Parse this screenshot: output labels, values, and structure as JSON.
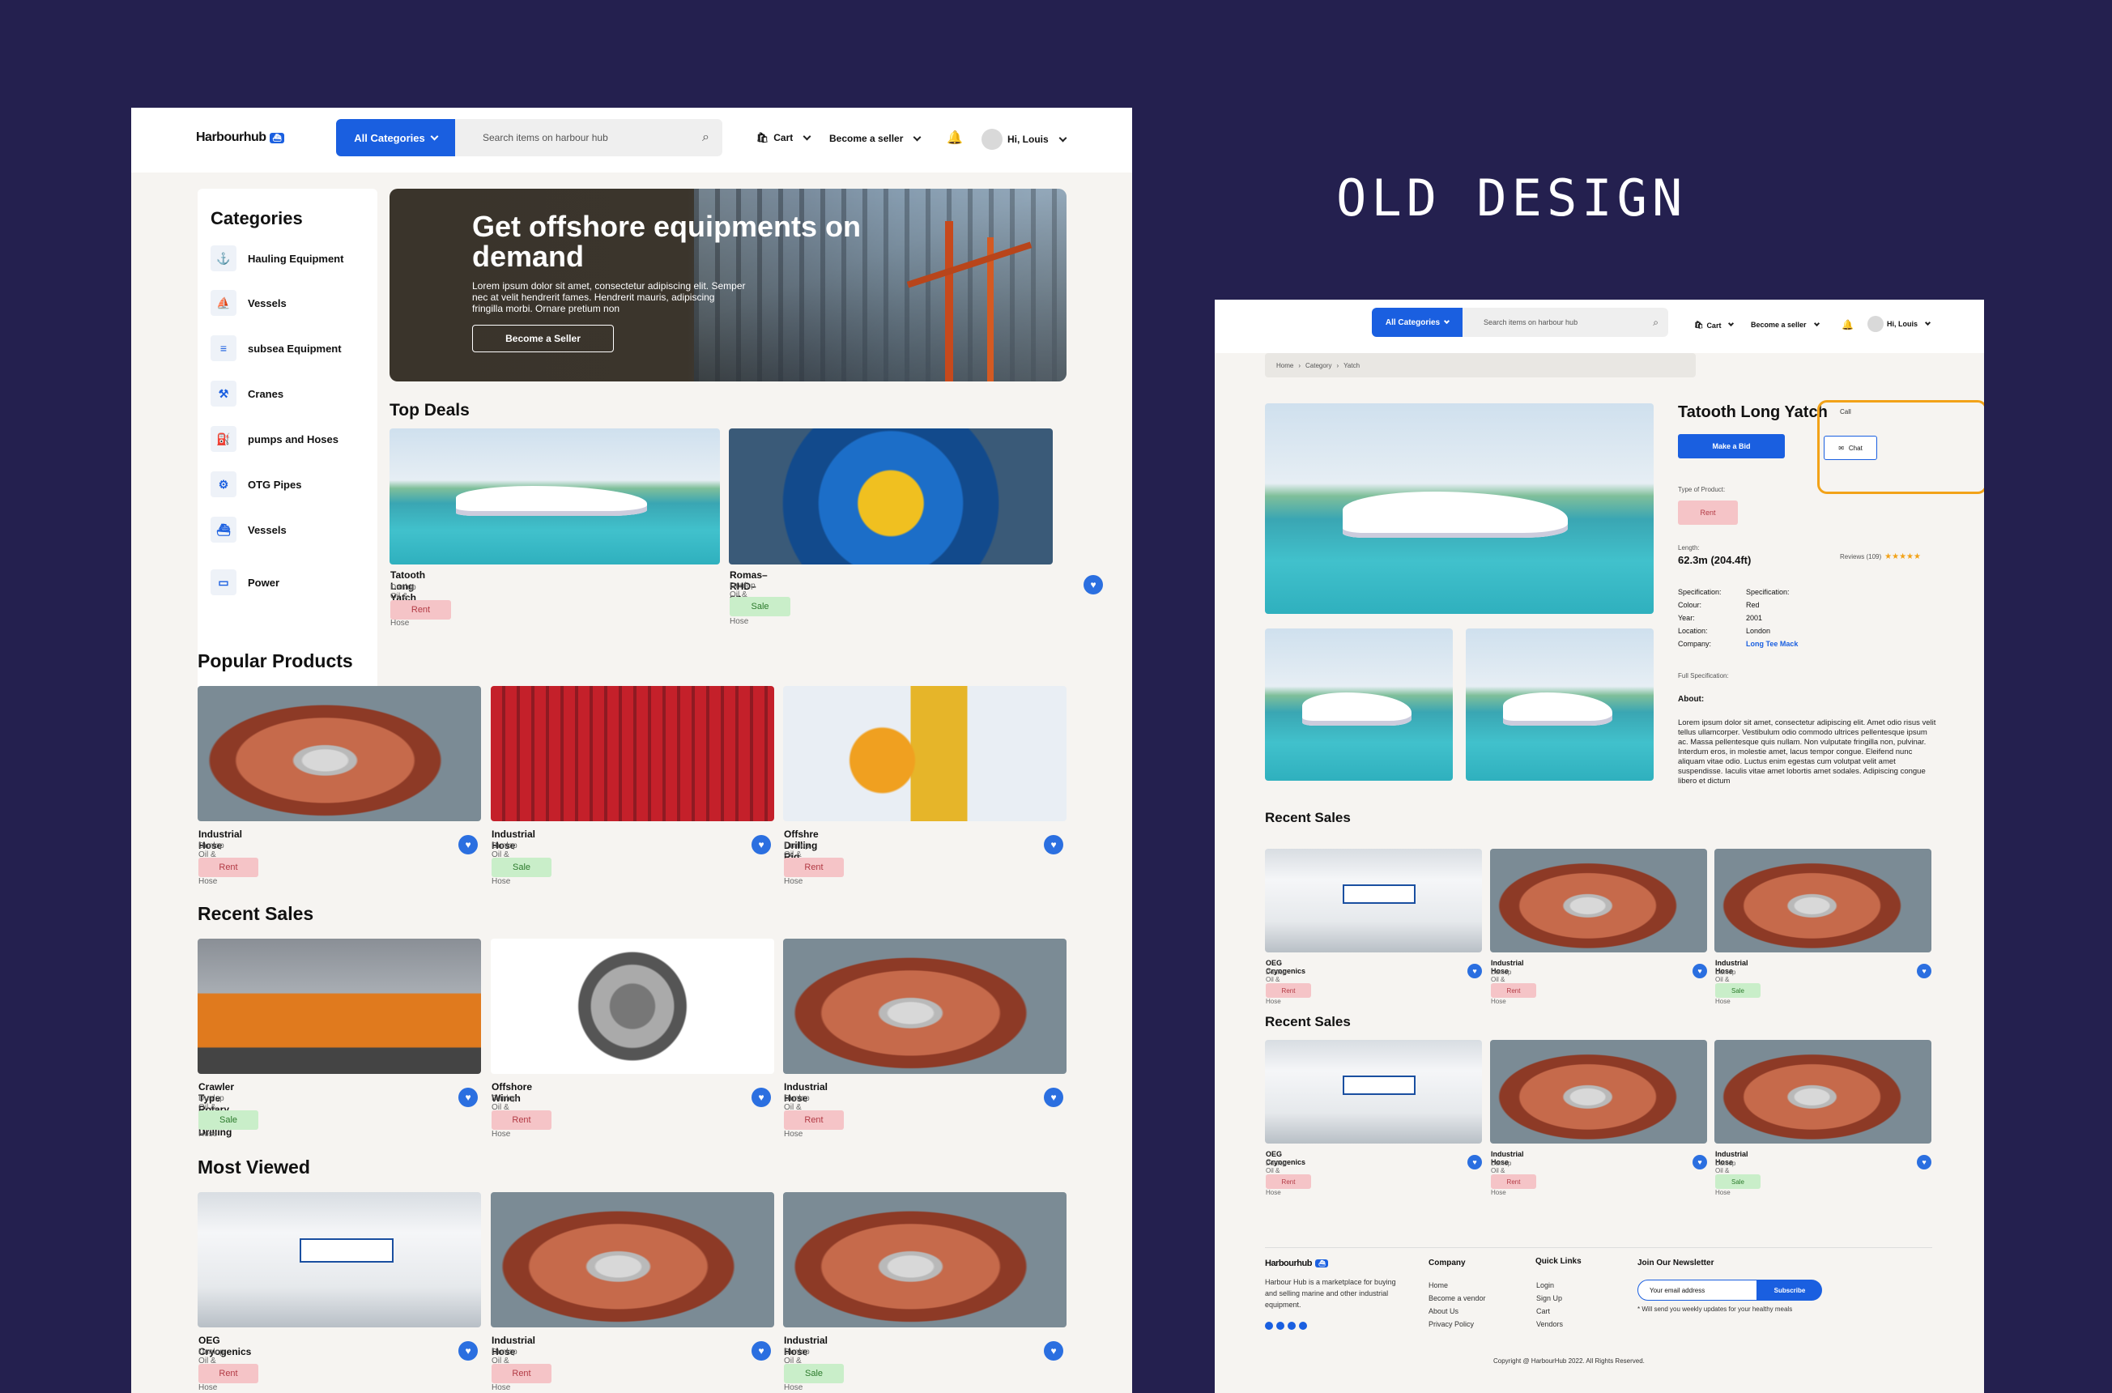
{
  "home": {
    "logo": "Harbourhub",
    "logo_mark": "⛴",
    "categories_button": "All Categories",
    "search_placeholder": "Search items on harbour hub",
    "cart": "Cart",
    "become_seller": "Become a seller",
    "greeting": "Hi, Louis",
    "categories_title": "Categories",
    "categories": [
      "Hauling Equipment",
      "Vessels",
      "subsea Equipment",
      "Cranes",
      "pumps and Hoses",
      "OTG Pipes",
      "Vessels",
      "Power"
    ],
    "hero": {
      "title": "Get offshore equipments on demand",
      "text": "Lorem ipsum dolor sit amet, consectetur adipiscing elit. Semper nec at velit hendrerit fames. Hendrerit mauris, adipiscing fringilla morbi. Ornare pretium non",
      "button": "Become a Seller"
    },
    "top_deals_title": "Top Deals",
    "top_deals": [
      {
        "title": "Tatooth Long Yatch",
        "subtitle": "Dunlop Oil & Marine Industrail Hose",
        "badge": "Rent"
      },
      {
        "title": "Romas–RHD–on–Pride",
        "subtitle": "Dunlop Oil & Marine Industrail Hose",
        "badge": "Sale"
      }
    ],
    "popular_title": "Popular Products",
    "popular": [
      {
        "title": "Industrial Hose",
        "subtitle": "Dunlop Oil & Marine Industrail Hose",
        "badge": "Rent"
      },
      {
        "title": "Industrial Hose",
        "subtitle": "Dunlop Oil & Marine Industrail Hose",
        "badge": "Sale"
      },
      {
        "title": "Offshre Drilling Rig",
        "subtitle": "Dunlop Oil & Marine Industrail Hose",
        "badge": "Rent"
      }
    ],
    "recent_title": "Recent Sales",
    "recent": [
      {
        "title": "Crawler Type Rotary Well Drilling",
        "subtitle": "Dunlop Oil & Marine Industrail Hose",
        "badge": "Sale"
      },
      {
        "title": "Offshore Winch",
        "subtitle": "Dunlop Oil & Marine Industrail Hose",
        "badge": "Rent"
      },
      {
        "title": "Industrial Hose",
        "subtitle": "Dunlop Oil & Marine Industrail Hose",
        "badge": "Rent"
      }
    ],
    "most_viewed_title": "Most Viewed",
    "most_viewed": [
      {
        "title": "OEG Cryogenics",
        "subtitle": "Dunlop Oil & Marine Industrail Hose",
        "badge": "Rent"
      },
      {
        "title": "Industrial Hose",
        "subtitle": "Dunlop Oil & Marine Industrail Hose",
        "badge": "Rent"
      },
      {
        "title": "Industrial Hose",
        "subtitle": "Dunlop Oil & Marine Industrail Hose",
        "badge": "Sale"
      }
    ]
  },
  "label": "OLD DESIGN",
  "detail": {
    "categories_button": "All Categories",
    "search_placeholder": "Search items on harbour hub",
    "cart": "Cart",
    "become_seller": "Become a seller",
    "greeting": "Hi, Louis",
    "breadcrumb": [
      "Home",
      "Category",
      "Yatch"
    ],
    "title": "Tatooth Long Yatch",
    "bid_button": "Make a Bid",
    "call": "Call",
    "chat": "Chat",
    "type_label": "Type of Product:",
    "type_value": "Rent",
    "length_label": "Length:",
    "length_value": "62.3m (204.4ft)",
    "reviews": "Reviews (109)",
    "stars": "★★★★★",
    "specs": [
      {
        "k": "Specification:",
        "v": "Specification:"
      },
      {
        "k": "Colour:",
        "v": "Red"
      },
      {
        "k": "Year:",
        "v": "2001"
      },
      {
        "k": "Location:",
        "v": "London"
      },
      {
        "k": "Company:",
        "v": "Long Tee Mack"
      }
    ],
    "full_spec": "Full Specification:",
    "about_title": "About:",
    "about_text": "Lorem ipsum dolor sit amet, consectetur adipiscing elit. Amet odio risus velit tellus ullamcorper. Vestibulum odio commodo ultrices pellentesque ipsum ac. Massa pellentesque quis nullam. Non vulputate fringilla non, pulvinar. Interdum eros, in molestie amet, lacus tempor congue. Eleifend nunc aliquam vitae odio. Luctus enim egestas cum volutpat velit amet suspendisse. Iaculis vitae amet lobortis amet sodales. Adipiscing congue libero et dictum",
    "recent_title_1": "Recent Sales",
    "recent_title_2": "Recent Sales",
    "recent": [
      {
        "title": "OEG Cryogenics",
        "subtitle": "Dunlop Oil & Marine Industrail Hose",
        "badge": "Rent"
      },
      {
        "title": "Industrial Hose",
        "subtitle": "Dunlop Oil & Marine Industrail Hose",
        "badge": "Rent"
      },
      {
        "title": "Industrial Hose",
        "subtitle": "Dunlop Oil & Marine Industrail Hose",
        "badge": "Sale"
      }
    ],
    "footer": {
      "logo": "Harbourhub",
      "about": "Harbour Hub is a marketplace for buying and selling marine and other industrial equipment.",
      "company_title": "Company",
      "company": [
        "Home",
        "Become a vendor",
        "About Us",
        "Privacy Policy"
      ],
      "links_title": "Quick Links",
      "links": [
        "Login",
        "Sign Up",
        "Cart",
        "Vendors"
      ],
      "newsletter_title": "Join Our Newsletter",
      "email_placeholder": "Your email address",
      "subscribe": "Subscribe",
      "note": "* Will send you weekly updates for your healthy meals",
      "copyright": "Copyright @ HarbourHub 2022. All Rights Reserved."
    }
  },
  "colors": {
    "primary": "#1a5fe0",
    "background": "#24204f",
    "rent": "#f5c4c7",
    "sale": "#c9eec9",
    "highlight": "#f2a218"
  }
}
